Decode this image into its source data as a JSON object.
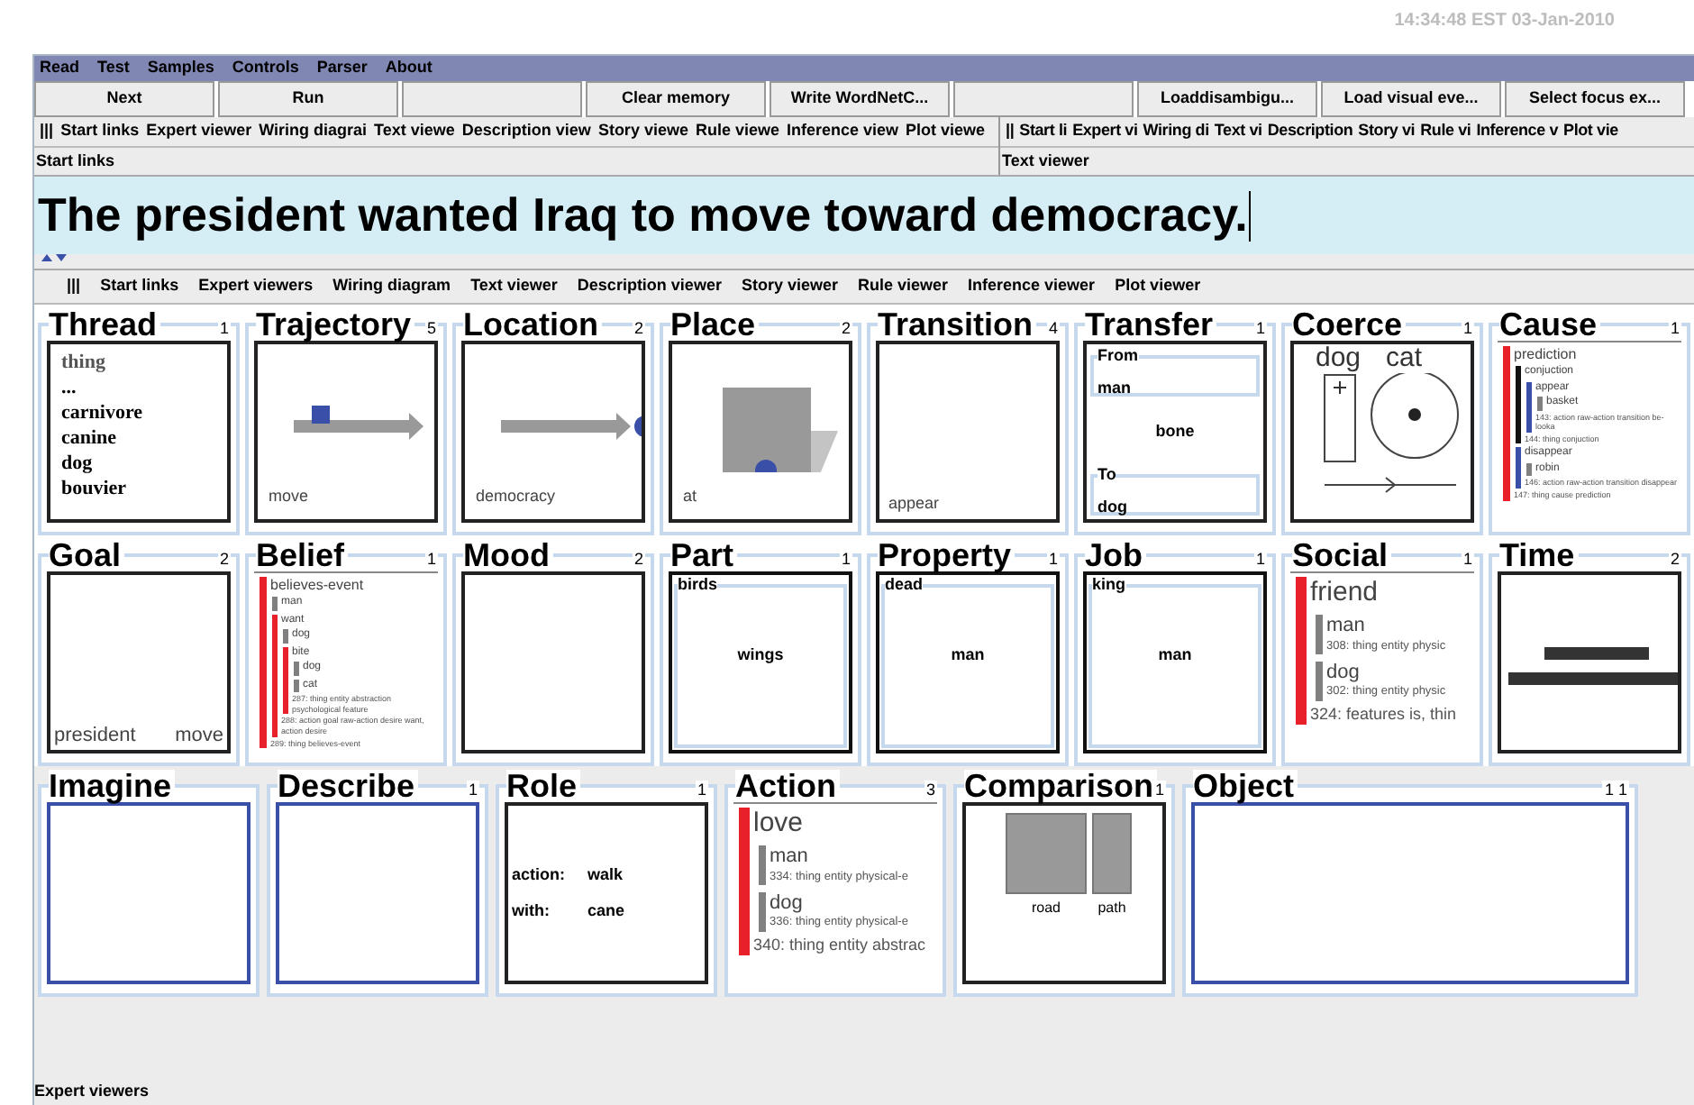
{
  "clock": "14:34:48 EST 03-Jan-2010",
  "menu": [
    "Read",
    "Test",
    "Samples",
    "Controls",
    "Parser",
    "About"
  ],
  "buttons": [
    {
      "kind": "text",
      "label": "Next"
    },
    {
      "kind": "text",
      "label": "Run"
    },
    {
      "kind": "blank"
    },
    {
      "kind": "text",
      "label": "Clear memory"
    },
    {
      "kind": "text",
      "label": "Write WordNetC..."
    },
    {
      "kind": "blank"
    },
    {
      "kind": "text",
      "label": "Loaddisambigu..."
    },
    {
      "kind": "text",
      "label": "Load visual eve..."
    },
    {
      "kind": "text",
      "label": "Select focus ex..."
    }
  ],
  "left_pane": {
    "grip": "|||",
    "tabs": [
      "Start links",
      "Expert viewer",
      "Wiring diagrai",
      "Text viewe",
      "Description view",
      "Story viewe",
      "Rule viewe",
      "Inference view",
      "Plot viewe"
    ],
    "label": "Start links"
  },
  "right_pane": {
    "grip": "||",
    "tabs": [
      "Start li",
      "Expert vi",
      "Wiring di",
      "Text vi",
      "Description",
      "Story vi",
      "Rule vi",
      "Inference v",
      "Plot vie"
    ],
    "label": "Text viewer"
  },
  "sentence": "The president wanted Iraq to move toward democracy.",
  "viewer_tabs": {
    "grip": "|||",
    "tabs": [
      "Start links",
      "Expert viewers",
      "Wiring diagram",
      "Text viewer",
      "Description viewer",
      "Story viewer",
      "Rule viewer",
      "Inference viewer",
      "Plot viewer"
    ]
  },
  "panel_rows": [
    [
      {
        "title": "Thread",
        "count": "1",
        "kind": "thread",
        "items": [
          "thing",
          "...",
          "carnivore",
          "canine",
          "dog",
          "bouvier"
        ]
      },
      {
        "title": "Trajectory",
        "count": "5",
        "kind": "trajectory",
        "labels": [
          "move"
        ]
      },
      {
        "title": "Location",
        "count": "2",
        "kind": "location",
        "labels": [
          "democracy"
        ]
      },
      {
        "title": "Place",
        "count": "2",
        "kind": "place",
        "labels": [
          "at"
        ]
      },
      {
        "title": "Transition",
        "count": "4",
        "kind": "caption",
        "labels": [
          "appear"
        ]
      },
      {
        "title": "Transfer",
        "count": "1",
        "kind": "transfer",
        "from": {
          "legend": "From",
          "value": "man"
        },
        "object": "bone",
        "to": {
          "legend": "To",
          "value": "dog"
        }
      },
      {
        "title": "Coerce",
        "count": "1",
        "kind": "coerce",
        "labels": [
          "dog",
          "cat"
        ]
      },
      {
        "title": "Cause",
        "count": "1",
        "kind": "minitree",
        "tree": {
          "label": "prediction",
          "color": "#e8202a",
          "children": [
            {
              "label": "conjuction",
              "color": "#111111",
              "children": [
                {
                  "label": "appear",
                  "color": "#3a4fa8",
                  "children": [
                    {
                      "label": "basket",
                      "color": "#808080"
                    }
                  ],
                  "note": "143: action raw-action transition be-looka"
                }
              ],
              "note": "144: thing conjuction"
            },
            {
              "label": "disappear",
              "color": "#3a4fa8",
              "children": [
                {
                  "label": "robin",
                  "color": "#808080"
                }
              ],
              "note": "146: action raw-action transition disappear"
            }
          ],
          "note": "147: thing cause prediction"
        }
      }
    ],
    [
      {
        "title": "Goal",
        "count": "2",
        "kind": "caption",
        "labels": [
          "president",
          "move"
        ]
      },
      {
        "title": "Belief",
        "count": "1",
        "kind": "minitree",
        "tree": {
          "label": "believes-event",
          "color": "#e8202a",
          "children": [
            {
              "label": "man",
              "color": "#808080"
            },
            {
              "label": "want",
              "color": "#e8202a",
              "children": [
                {
                  "label": "dog",
                  "color": "#808080"
                },
                {
                  "label": "bite",
                  "color": "#e8202a",
                  "children": [
                    {
                      "label": "dog",
                      "color": "#808080"
                    },
                    {
                      "label": "cat",
                      "color": "#808080"
                    }
                  ],
                  "note": "287: thing entity abstraction psychological feature"
                }
              ],
              "note": "288: action goal raw-action desire want, action desire"
            }
          ],
          "note": "289: thing believes-event"
        }
      },
      {
        "title": "Mood",
        "count": "2",
        "kind": "caption"
      },
      {
        "title": "Part",
        "count": "1",
        "kind": "frame",
        "outer": "birds",
        "inner": "wings"
      },
      {
        "title": "Property",
        "count": "1",
        "kind": "frame",
        "outer": "dead",
        "inner": "man"
      },
      {
        "title": "Job",
        "count": "1",
        "kind": "frame",
        "outer": "king",
        "inner": "man"
      },
      {
        "title": "Social",
        "count": "1",
        "kind": "tree",
        "tree": {
          "label": "friend",
          "color": "#e8202a",
          "children": [
            {
              "label": "man",
              "color": "#808080",
              "note": "308: thing entity physic"
            },
            {
              "label": "dog",
              "color": "#808080",
              "note": "302: thing entity physic"
            }
          ],
          "note": "324: features is, thin"
        }
      },
      {
        "title": "Time",
        "count": "2",
        "kind": "time"
      }
    ],
    [
      {
        "title": "Imagine",
        "kind": "blank"
      },
      {
        "title": "Describe",
        "count": "1",
        "kind": "blank"
      },
      {
        "title": "Role",
        "count": "1",
        "kind": "role",
        "rows": [
          {
            "key": "action:",
            "value": "walk"
          },
          {
            "key": "with:",
            "value": "cane"
          }
        ]
      },
      {
        "title": "Action",
        "count": "3",
        "kind": "tree",
        "tree": {
          "label": "love",
          "color": "#e8202a",
          "children": [
            {
              "label": "man",
              "color": "#808080",
              "note": "334: thing entity physical-e"
            },
            {
              "label": "dog",
              "color": "#808080",
              "note": "336: thing entity physical-e"
            }
          ],
          "note": "340: thing entity abstrac"
        }
      },
      {
        "title": "Comparison",
        "count": "1",
        "kind": "comparison",
        "labels": [
          "road",
          "path"
        ]
      },
      {
        "title": "Object",
        "count": "1 1",
        "kind": "blank"
      }
    ]
  ],
  "status": "Expert viewers"
}
